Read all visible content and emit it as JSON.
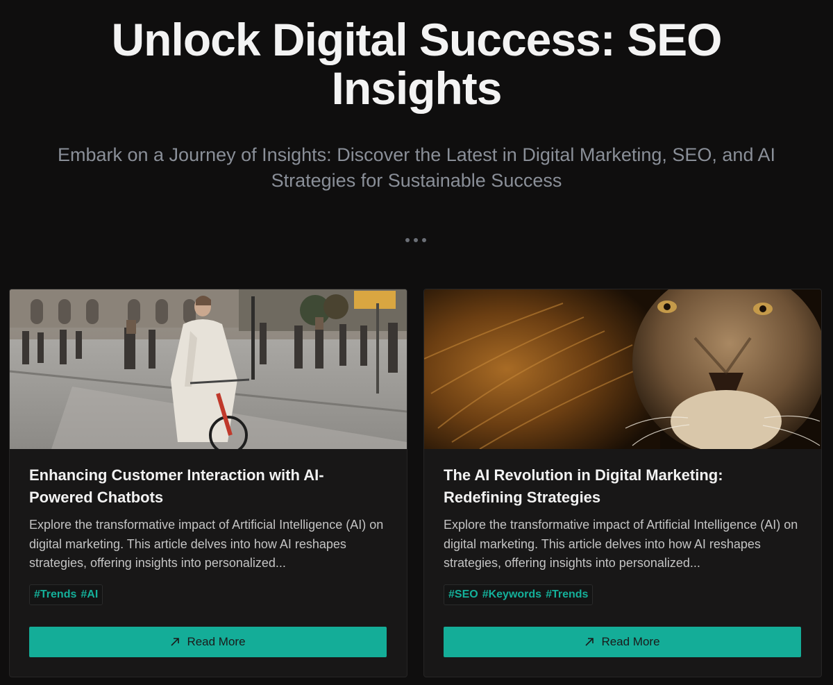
{
  "hero": {
    "title": "Unlock Digital Success: SEO Insights",
    "subtitle": "Embark on a Journey of Insights: Discover the Latest in Digital Marketing, SEO, and AI Strategies for Sustainable Success"
  },
  "pagination_icon": "more-dots-icon",
  "cards": [
    {
      "image_icon": "street-cyclist-photo",
      "title": "Enhancing Customer Interaction with AI-Powered Chatbots",
      "excerpt": "Explore the transformative impact of Artificial Intelligence (AI) on digital marketing. This article delves into how AI reshapes strategies, offering insights into personalized...",
      "tags": [
        "#Trends",
        "#AI"
      ],
      "button_label": "Read More",
      "button_icon": "arrow-up-right-icon"
    },
    {
      "image_icon": "lion-photo",
      "title": "The AI Revolution in Digital Marketing: Redefining Strategies",
      "excerpt": "Explore the transformative impact of Artificial Intelligence (AI) on digital marketing. This article delves into how AI reshapes strategies, offering insights into personalized...",
      "tags": [
        "#SEO",
        "#Keywords",
        "#Trends"
      ],
      "button_label": "Read More",
      "button_icon": "arrow-up-right-icon"
    }
  ],
  "colors": {
    "background": "#0f0e0e",
    "card": "#181717",
    "accent": "#14ad98",
    "subtitle": "#8a8f98"
  }
}
